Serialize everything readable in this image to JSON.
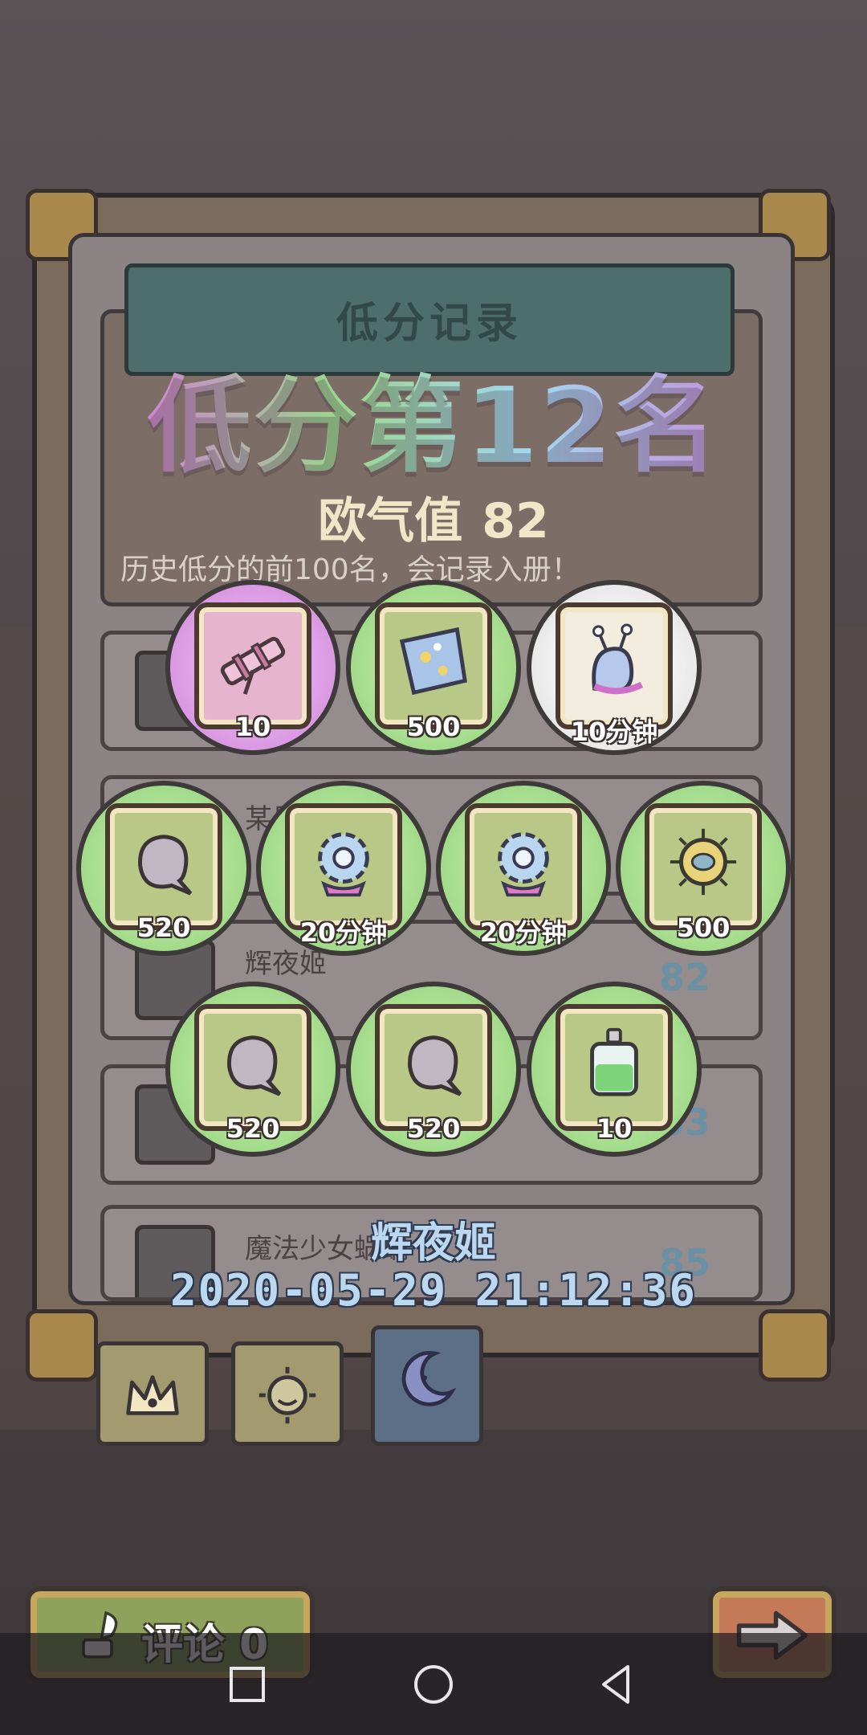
{
  "header": {
    "panel_title": "低分记录",
    "rank_title": "低分第12名",
    "luck_label": "欧气值",
    "luck_value": "82",
    "hint": "历史低分的前100名，会记录入册！"
  },
  "list_rows": [
    {
      "name": "",
      "score": ""
    },
    {
      "name": "某果",
      "score": ""
    },
    {
      "name": "辉夜姬",
      "score": "82"
    },
    {
      "name": "",
      "score": "83"
    },
    {
      "name": "魔法少女蜗蜗",
      "score": "85"
    }
  ],
  "rewards": [
    {
      "icon": "telescope-icon",
      "qty": "10",
      "style": "purple"
    },
    {
      "icon": "blue-cloth-icon",
      "qty": "500",
      "style": "green"
    },
    {
      "icon": "snail-slug-icon",
      "qty": "10分钟",
      "style": "white"
    },
    {
      "icon": "gray-blob-icon",
      "qty": "520",
      "style": "green"
    },
    {
      "icon": "gear-icon",
      "qty": "20分钟",
      "style": "green"
    },
    {
      "icon": "gear-icon",
      "qty": "20分钟",
      "style": "green"
    },
    {
      "icon": "virus-shield-icon",
      "qty": "500",
      "style": "green"
    },
    {
      "icon": "gray-blob-icon",
      "qty": "520",
      "style": "green"
    },
    {
      "icon": "gray-blob-icon",
      "qty": "520",
      "style": "green"
    },
    {
      "icon": "potion-bottle-icon",
      "qty": "10",
      "style": "green"
    }
  ],
  "record": {
    "owner": "辉夜姬",
    "datetime": "2020-05-29 21:12:36"
  },
  "tabs": [
    {
      "icon": "crown-icon",
      "active": false
    },
    {
      "icon": "sun-face-icon",
      "active": false
    },
    {
      "icon": "moon-face-icon",
      "active": true
    }
  ],
  "buttons": {
    "comment_label": "评论",
    "comment_count": "0",
    "next_icon": "arrow-right-icon"
  },
  "system_nav": [
    "recent-apps-icon",
    "home-icon",
    "back-icon"
  ],
  "colors": {
    "reward_green": "#8fd07a",
    "reward_purple": "#c98ad6",
    "date_text": "#bcd8f0"
  }
}
